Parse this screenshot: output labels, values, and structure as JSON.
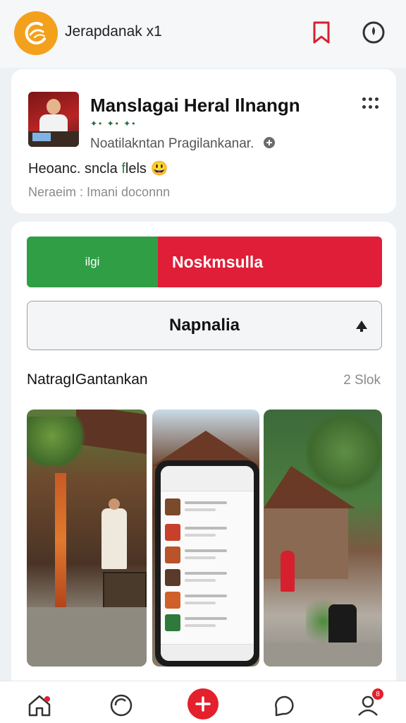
{
  "header": {
    "app_title": "Jerapdanak x1",
    "icons": [
      "logo-icon",
      "bookmark-icon",
      "timer-icon"
    ]
  },
  "post": {
    "title": "Manslagai Heral Ilnangn",
    "sub_icons": "✦• ✦• ✦•",
    "meta": "Noatilakntan Pragilankanar.",
    "body_prefix": "Heoanc. sncla",
    "body_green": "f",
    "body_suffix": "lels",
    "emoji": "😃",
    "note": "Neraeim : Imani doconnn"
  },
  "vote": {
    "left_label": "ilgi",
    "right_label": "Noskmsulla",
    "left_share": 0.37,
    "colors": {
      "left": "#2f9e44",
      "right": "#e01e37"
    }
  },
  "action": {
    "label": "Napnalia"
  },
  "gallery": {
    "title": "NatragIGantankan",
    "count": "2 Slok"
  },
  "nav": {
    "items": [
      "home-icon",
      "refresh-icon",
      "add-icon",
      "chat-icon",
      "profile-icon"
    ],
    "badge": "8"
  }
}
